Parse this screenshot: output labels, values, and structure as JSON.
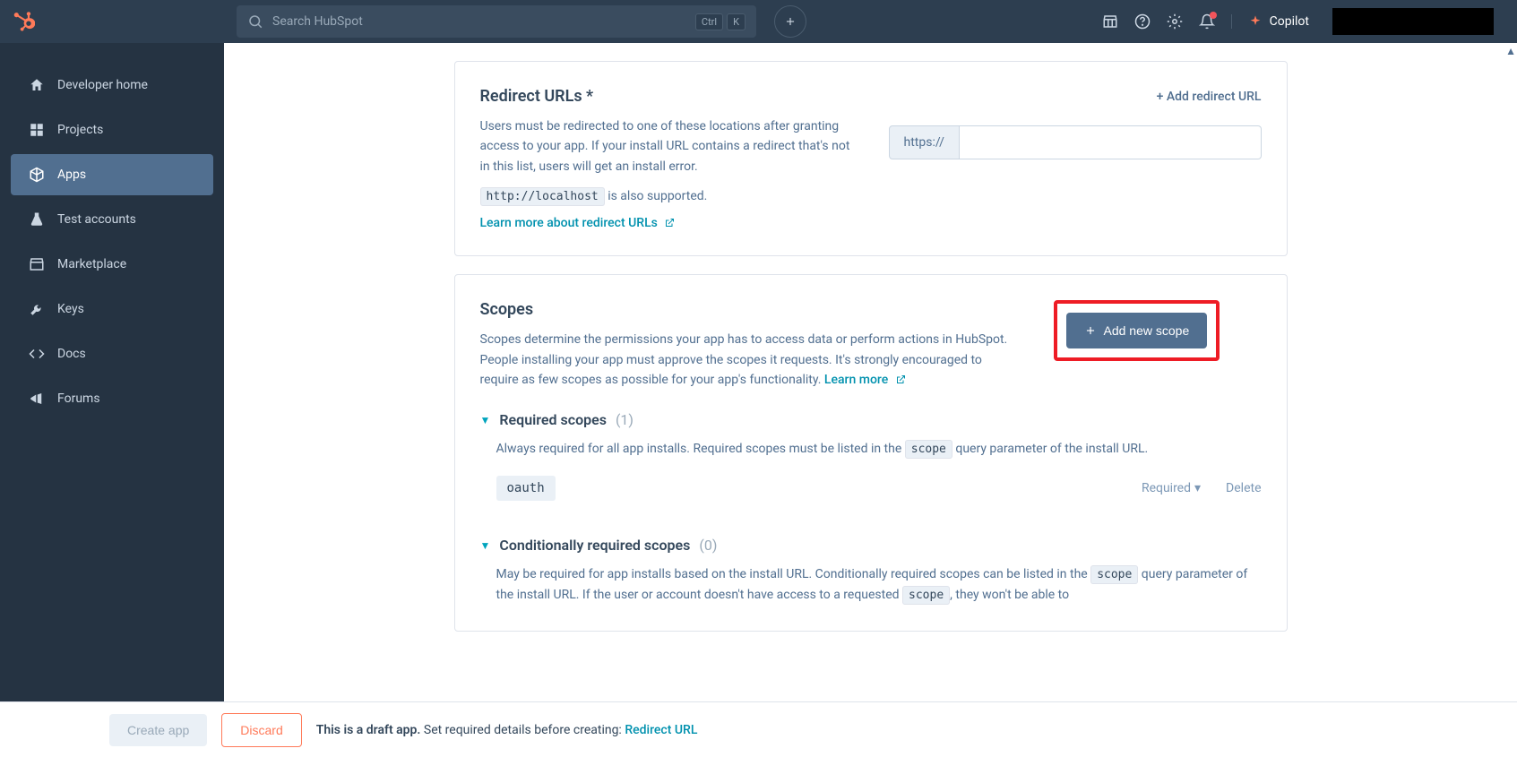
{
  "header": {
    "search_placeholder": "Search HubSpot",
    "kbd_ctrl": "Ctrl",
    "kbd_k": "K",
    "copilot_label": "Copilot"
  },
  "sidebar": {
    "items": [
      {
        "label": "Developer home",
        "icon": "home"
      },
      {
        "label": "Projects",
        "icon": "projects"
      },
      {
        "label": "Apps",
        "icon": "apps",
        "active": true
      },
      {
        "label": "Test accounts",
        "icon": "flask"
      },
      {
        "label": "Marketplace",
        "icon": "store"
      },
      {
        "label": "Keys",
        "icon": "wrench"
      },
      {
        "label": "Docs",
        "icon": "code"
      },
      {
        "label": "Forums",
        "icon": "megaphone"
      }
    ]
  },
  "redirect": {
    "title": "Redirect URLs *",
    "desc": "Users must be redirected to one of these locations after granting access to your app. If your install URL contains a redirect that's not in this list, users will get an install error.",
    "add_label": "+ Add redirect URL",
    "url_prefix": "https://",
    "localhost_code": "http://localhost",
    "localhost_suffix": " is also supported.",
    "learn_link": "Learn more about redirect URLs"
  },
  "scopes": {
    "title": "Scopes",
    "desc": "Scopes determine the permissions your app has to access data or perform actions in HubSpot. People installing your app must approve the scopes it requests. It's strongly encouraged to require as few scopes as possible for your app's functionality. ",
    "learn_link": "Learn more",
    "add_button": "Add new scope",
    "required": {
      "title": "Required scopes",
      "count": "(1)",
      "desc_prefix": "Always required for all app installs. Required scopes must be listed in the ",
      "code": "scope",
      "desc_suffix": " query parameter of the install URL.",
      "item": "oauth",
      "action_required": "Required",
      "action_delete": "Delete"
    },
    "conditional": {
      "title": "Conditionally required scopes",
      "count": "(0)",
      "desc_prefix": "May be required for app installs based on the install URL. Conditionally required scopes can be listed in the ",
      "code1": "scope",
      "desc_mid": " query parameter of the install URL. If the user or account doesn't have access to a requested ",
      "code2": "scope",
      "desc_suffix": ", they won't be able to"
    }
  },
  "footer": {
    "create_label": "Create app",
    "discard_label": "Discard",
    "draft_strong": "This is a draft app.",
    "draft_rest": " Set required details before creating: ",
    "redirect_link": "Redirect URL"
  }
}
